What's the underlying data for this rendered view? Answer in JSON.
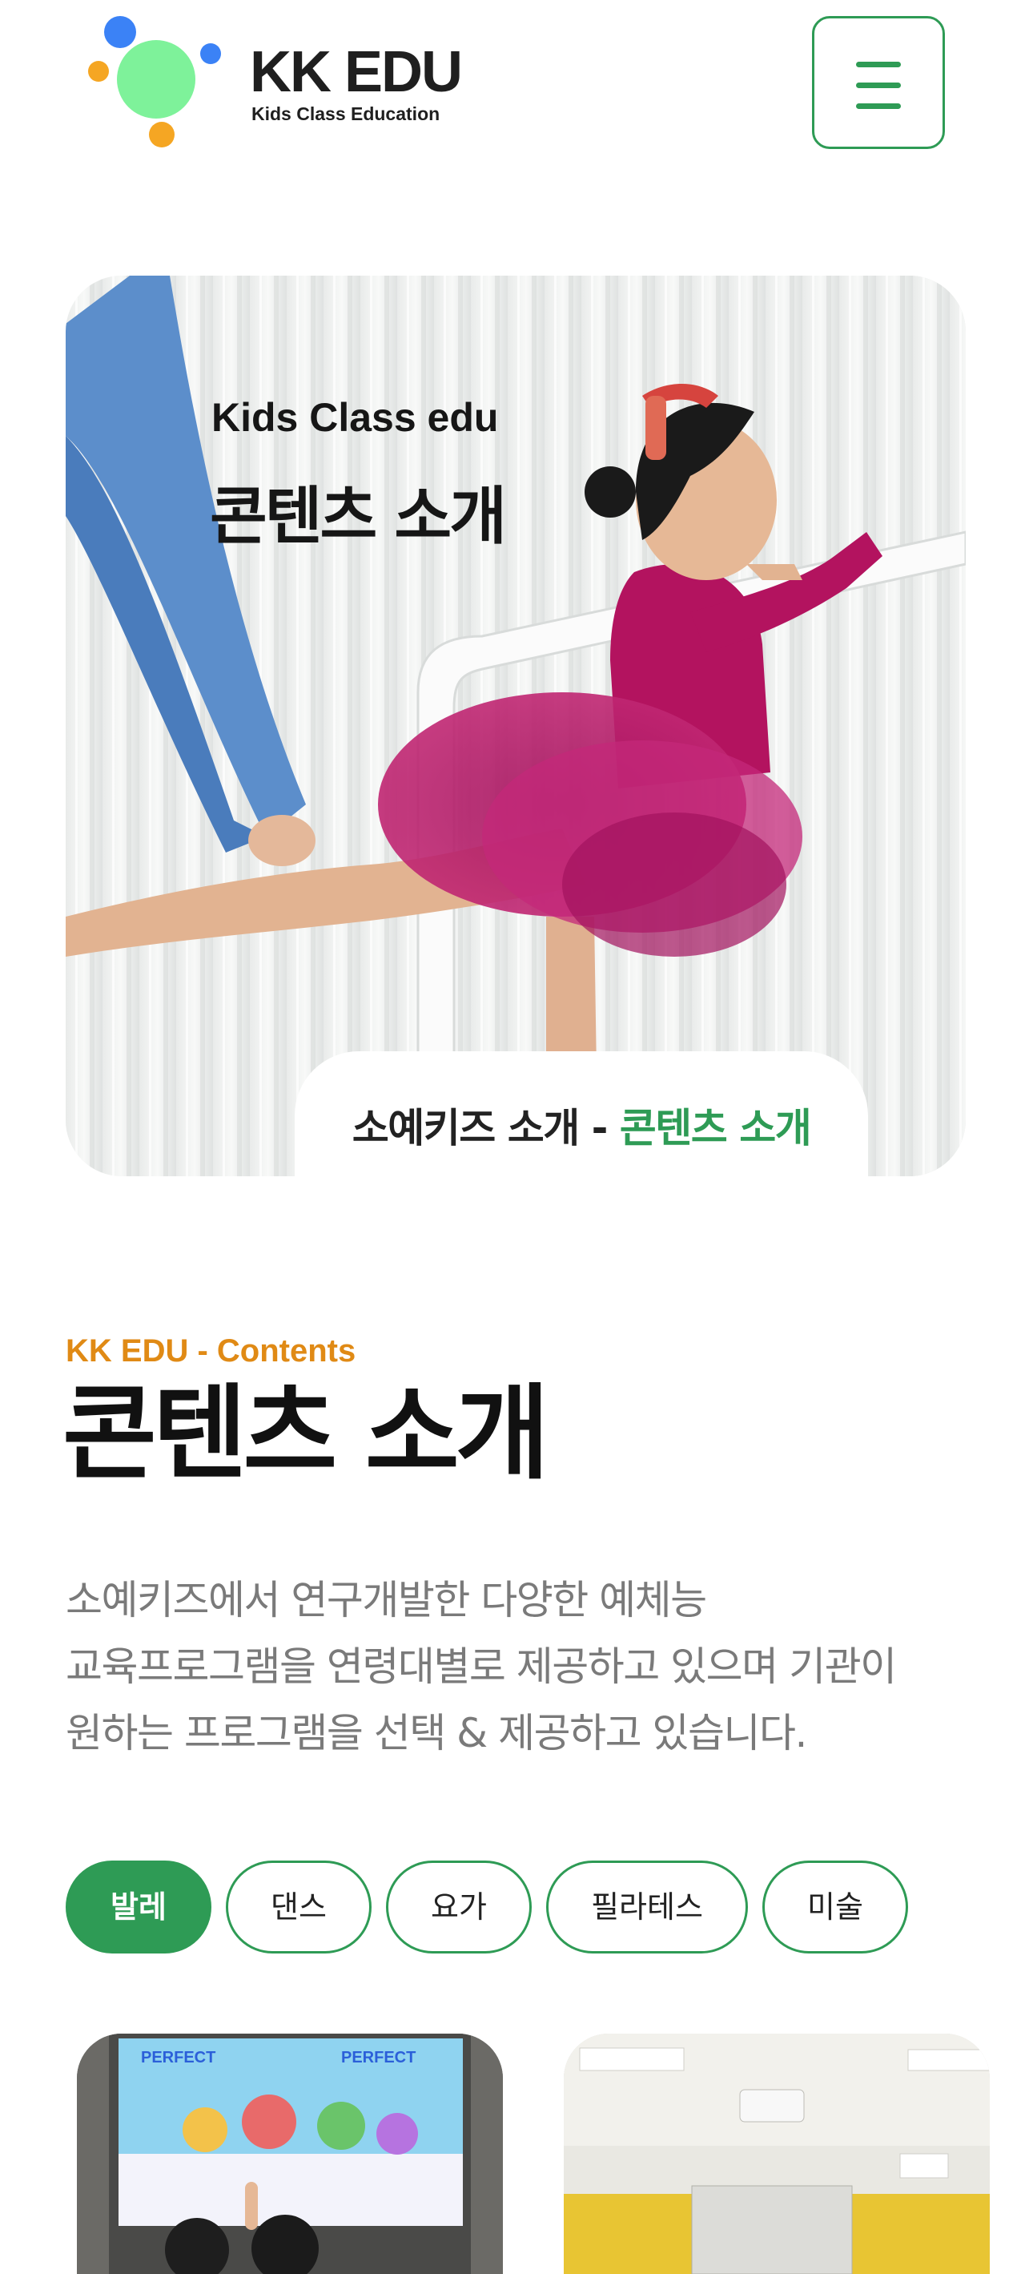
{
  "header": {
    "logo_title": "KK EDU",
    "logo_subtitle": "Kids Class Education",
    "menu_icon": "hamburger-menu-icon",
    "colors": {
      "brand_green": "#2e9b55",
      "logo_blue": "#3b82f6",
      "logo_orange": "#f5a623",
      "logo_mint": "#7ef29a"
    }
  },
  "hero": {
    "eyebrow": "Kids Class edu",
    "title": "콘텐츠 소개",
    "breadcrumb": {
      "base": "소예키즈 소개",
      "separator": " - ",
      "current": "콘텐츠 소개"
    }
  },
  "section": {
    "eyebrow": "KK EDU - Contents",
    "title": "콘텐츠 소개",
    "description_lines": [
      "소예키즈에서 연구개발한 다양한 예체능",
      "교육프로그램을 연령대별로 제공하고 있으며 기관이",
      "원하는 프로그램을 선택 & 제공하고 있습니다."
    ],
    "colors": {
      "eyebrow": "#e08a15"
    }
  },
  "tabs": {
    "selected": "발레",
    "items": [
      {
        "label": "발레"
      },
      {
        "label": "댄스"
      },
      {
        "label": "요가"
      },
      {
        "label": "필라테스"
      },
      {
        "label": "미술"
      }
    ]
  },
  "cards": {
    "left_screen_labels": [
      "PERFECT",
      "PERFECT"
    ]
  }
}
